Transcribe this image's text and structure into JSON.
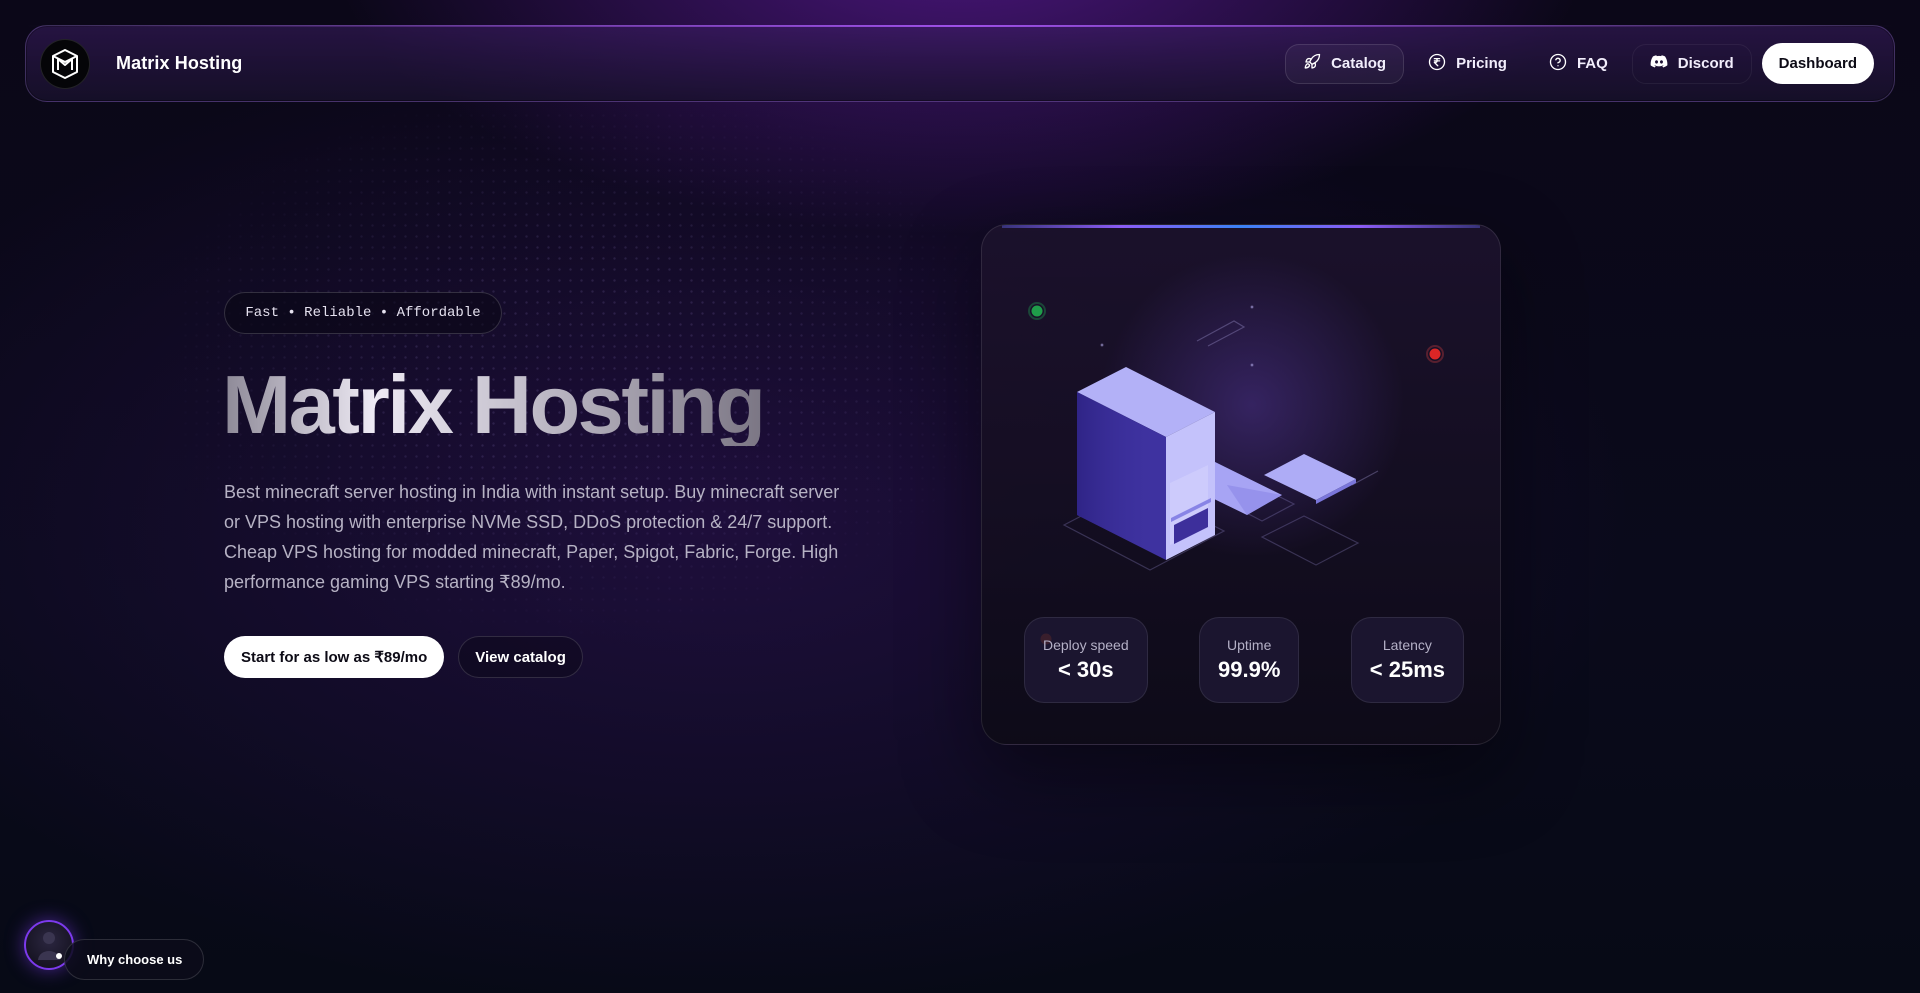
{
  "nav": {
    "brand": "Matrix Hosting",
    "links": [
      {
        "label": "Catalog",
        "icon": "rocket-icon"
      },
      {
        "label": "Pricing",
        "icon": "rupee-icon"
      },
      {
        "label": "FAQ",
        "icon": "help-circle-icon"
      },
      {
        "label": "Discord",
        "icon": "discord-icon"
      }
    ],
    "dashboard_label": "Dashboard"
  },
  "hero": {
    "tagline": "Fast • Reliable • Affordable",
    "title": "Matrix Hosting",
    "description": "Best minecraft server hosting in India with instant setup. Buy minecraft server or VPS hosting with enterprise NVMe SSD, DDoS protection & 24/7 support. Cheap VPS hosting for modded minecraft, Paper, Spigot, Fabric, Forge. High performance gaming VPS starting ₹89/mo.",
    "cta_primary": "Start for as low as ₹89/mo",
    "cta_secondary": "View catalog"
  },
  "card": {
    "stats": [
      {
        "label": "Deploy speed",
        "value": "< 30s"
      },
      {
        "label": "Uptime",
        "value": "99.9%"
      },
      {
        "label": "Latency",
        "value": "< 25ms"
      }
    ]
  },
  "footer": {
    "why_label": "Why choose us"
  },
  "colors": {
    "accent": "#8b5cf6",
    "background": "#0a0a1b",
    "status_green": "#22c55e",
    "status_red": "#ef4444"
  }
}
